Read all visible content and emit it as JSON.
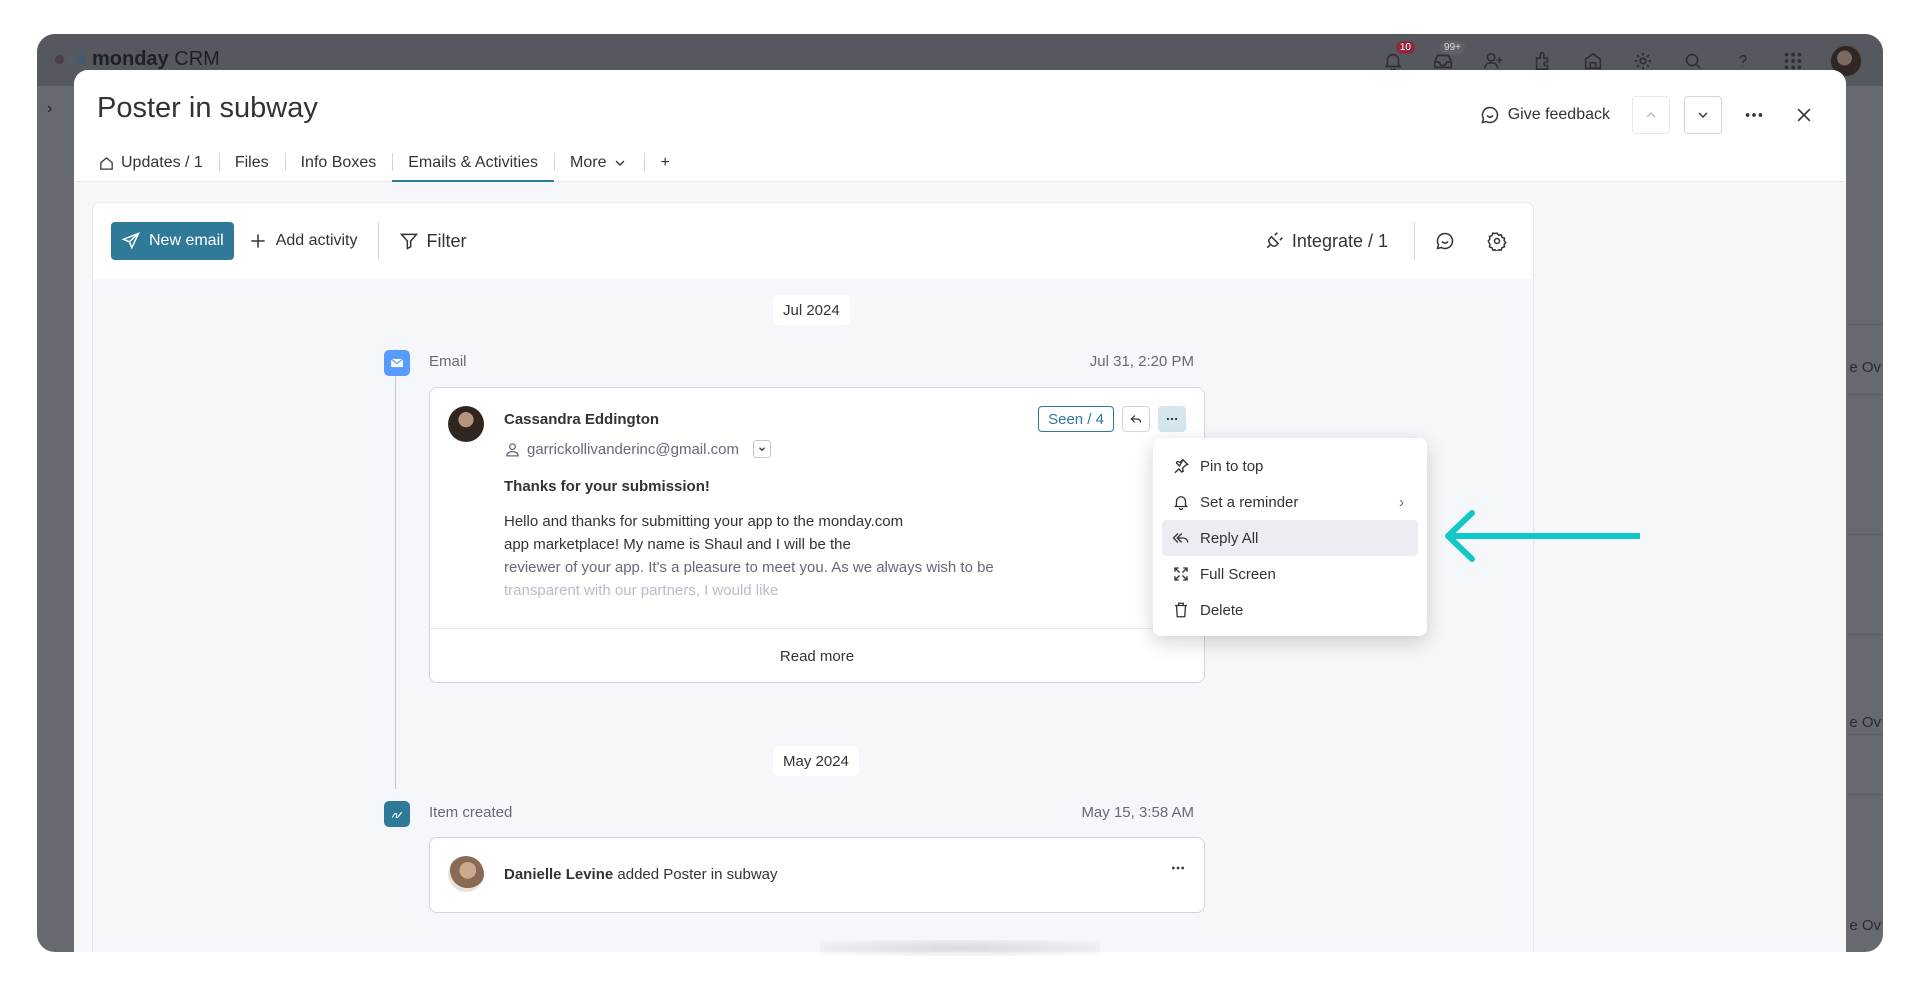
{
  "app": {
    "logo_text": "monday",
    "logo_suffix": "CRM",
    "notifications_badge": "10",
    "inbox_badge": "99+",
    "bg_partial_label": "e Ov"
  },
  "modal": {
    "title": "Poster in subway",
    "give_feedback": "Give feedback",
    "tabs": [
      {
        "label": "Updates / 1"
      },
      {
        "label": "Files"
      },
      {
        "label": "Info Boxes"
      },
      {
        "label": "Emails & Activities"
      },
      {
        "label": "More"
      },
      {
        "label": "+"
      }
    ]
  },
  "toolbar": {
    "new_email": "New email",
    "add_activity": "Add activity",
    "filter": "Filter",
    "integrate": "Integrate / 1"
  },
  "feed": {
    "groups": [
      {
        "month": "Jul 2024",
        "type_label": "Email",
        "date": "Jul 31, 2:20 PM",
        "sender_name": "Cassandra Eddington",
        "sender_email": "garrickollivanderinc@gmail.com",
        "seen": "Seen / 4",
        "subject": "Thanks for your submission!",
        "body_lines": [
          "Hello and thanks for submitting your app to the monday.com",
          "app marketplace! My name is Shaul and I will be the",
          "reviewer of your app. It's a pleasure to meet you. As we always wish to be",
          "transparent with our partners, I would like"
        ],
        "read_more": "Read more"
      },
      {
        "month": "May 2024",
        "type_label": "Item created",
        "date": "May 15, 3:58 AM",
        "actor": "Danielle Levine",
        "action": "added Poster in subway"
      }
    ]
  },
  "context_menu": {
    "items": [
      {
        "label": "Pin to top",
        "icon": "pin-icon"
      },
      {
        "label": "Set a reminder",
        "icon": "bell-icon",
        "has_submenu": true
      },
      {
        "label": "Reply All",
        "icon": "reply-all-icon",
        "highlighted": true
      },
      {
        "label": "Full Screen",
        "icon": "fullscreen-icon"
      },
      {
        "label": "Delete",
        "icon": "trash-icon"
      }
    ]
  },
  "colors": {
    "accent": "#2f7a98",
    "annotation_arrow": "#12c7c9",
    "overlay": "#66696f"
  }
}
